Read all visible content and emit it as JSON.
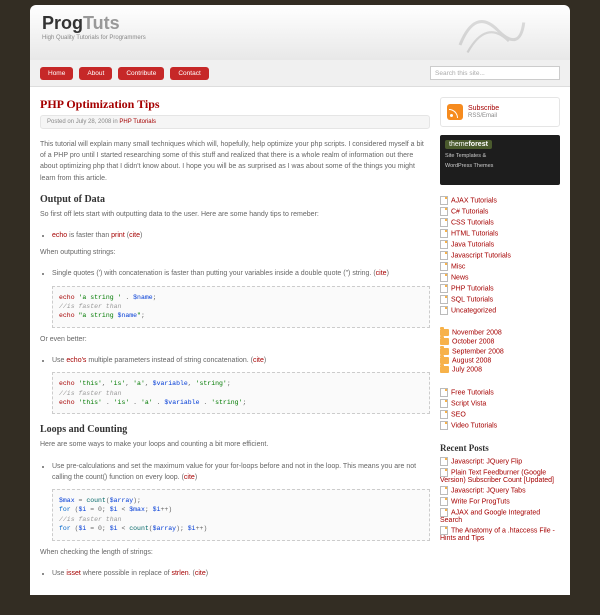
{
  "logo": {
    "a": "Prog",
    "b": "Tuts"
  },
  "tagline": "High Quality Tutorials for Programmers",
  "nav": [
    "Home",
    "About",
    "Contribute",
    "Contact"
  ],
  "search_placeholder": "Search this site...",
  "post": {
    "title": "PHP Optimization Tips",
    "meta_pre": "Posted on ",
    "meta_date": "July 28, 2008",
    "meta_in": " in ",
    "meta_cat": "PHP Tutorials",
    "intro": "This tutorial will explain many small techniques which will, hopefully, help optimize your php scripts. I considered myself a bit of a PHP pro until I started researching some of this stuff and realized that there is a whole realm of information out there about optimizing php that I didn't know about. I hope you will be as surprised as I was about some of the things you might learn from this article.",
    "h_output": "Output of Data",
    "output_sub": "So first off lets start with outputting data to the user. Here are some handy tips to remeber:",
    "li_echo_a": "echo",
    "li_echo_b": " is faster than ",
    "li_echo_c": "print",
    "li_echo_d": " (",
    "li_echo_e": "cite",
    "li_echo_f": ")",
    "when_strings": "When outputting strings:",
    "li_quotes_a": "Single quotes (') with concatenation is faster than putting your variables inside a double quote (\") string. (",
    "li_quotes_b": "cite",
    "li_quotes_c": ")",
    "or_better": "Or even better:",
    "li_params_a": "Use ",
    "li_params_b": "echo's",
    "li_params_c": " multiple parameters instead of string concatenation. (",
    "li_params_d": "cite",
    "li_params_e": ")",
    "h_loops": "Loops and Counting",
    "loops_sub": "Here are some ways to make your loops and counting a bit more efficient.",
    "li_precalc_a": "Use pre-calculations and set the maximum value for your for-loops before and not in the loop. This means you are not calling the count() function on every loop. (",
    "li_precalc_b": "cite",
    "li_precalc_c": ")",
    "when_length": "When checking the length of strings:",
    "li_isset_a": "Use ",
    "li_isset_b": "isset",
    "li_isset_c": " where possible in replace of ",
    "li_isset_d": "strlen",
    "li_isset_e": ". (",
    "li_isset_f": "cite",
    "li_isset_g": ")"
  },
  "code1": {
    "l1a": "echo ",
    "l1b": "'a string ' ",
    "l1c": ". ",
    "l1d": "$name",
    "l1e": ";",
    "l2": "//is faster than",
    "l3a": "echo ",
    "l3b": "\"a string ",
    "l3c": "$name",
    "l3d": "\"",
    "l3e": ";"
  },
  "code2": {
    "l1a": "echo ",
    "l1b": "'this'",
    "l1c": ", ",
    "l1d": "'is'",
    "l1e": ", ",
    "l1f": "'a'",
    "l1g": ", ",
    "l1h": "$variable",
    "l1i": ", ",
    "l1j": "'string'",
    "l1k": ";",
    "l2": "//is faster than",
    "l3a": "echo ",
    "l3b": "'this' ",
    "l3c": ". ",
    "l3d": "'is' ",
    "l3e": ". ",
    "l3f": "'a' ",
    "l3g": ". ",
    "l3h": "$variable ",
    "l3i": ". ",
    "l3j": "'string'",
    "l3k": ";"
  },
  "code3": {
    "l1a": "$max ",
    "l1b": "= ",
    "l1c": "count",
    "l1d": "(",
    "l1e": "$array",
    "l1f": ");",
    "l2a": "for ",
    "l2b": "(",
    "l2c": "$i ",
    "l2d": "= 0; ",
    "l2e": "$i ",
    "l2f": "< ",
    "l2g": "$max",
    "l2h": "; ",
    "l2i": "$i",
    "l2j": "++)",
    "l3": "//is faster than",
    "l4a": "for ",
    "l4b": "(",
    "l4c": "$i ",
    "l4d": "= 0; ",
    "l4e": "$i ",
    "l4f": "< ",
    "l4g": "count",
    "l4h": "(",
    "l4i": "$array",
    "l4j": "); ",
    "l4k": "$i",
    "l4l": "++)"
  },
  "subscribe": {
    "title": "Subscribe",
    "sub": "RSS/Email"
  },
  "promo": {
    "brand_a": "theme",
    "brand_b": "forest",
    "l1": "Site Templates &",
    "l2": "WordPress Themes"
  },
  "categories": [
    "AJAX Tutorials",
    "C# Tutorials",
    "CSS Tutorials",
    "HTML Tutorials",
    "Java Tutorials",
    "Javascript Tutorials",
    "Misc",
    "News",
    "PHP Tutorials",
    "SQL Tutorials",
    "Uncategorized"
  ],
  "archives": [
    "November 2008",
    "October 2008",
    "September 2008",
    "August 2008",
    "July 2008"
  ],
  "links": [
    "Free Tutorials",
    "Script Vista",
    "SEO",
    "Video Tutorials"
  ],
  "recent_h": "Recent Posts",
  "recent": [
    "Javascript: JQuery Flip",
    "Plain Text Feedburner (Google Version) Subscriber Count [Updated]",
    "Javascript: JQuery Tabs",
    "Write For ProgTuts",
    "AJAX and Google Integrated Search",
    "The Anatomy of a .htaccess File - Hints and Tips"
  ]
}
